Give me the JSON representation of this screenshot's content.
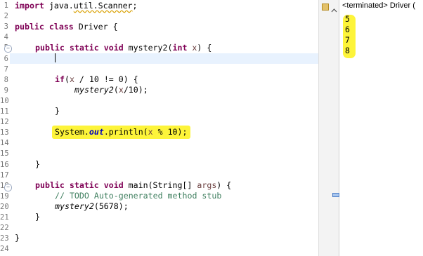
{
  "editor": {
    "line_numbers": [
      "1",
      "2",
      "3",
      "4",
      "5",
      "6",
      "7",
      "8",
      "9",
      "10",
      "11",
      "12",
      "13",
      "14",
      "15",
      "16",
      "17",
      "18",
      "19",
      "20",
      "21",
      "22",
      "23",
      "24"
    ],
    "code": {
      "l1_kw": "import",
      "l1_rest_a": " java.",
      "l1_squig": "util.Scanner",
      "l1_rest_b": ";",
      "l3_kw1": "public",
      "l3_kw2": "class",
      "l3_rest": " Driver {",
      "l5_kw1": "public",
      "l5_kw2": "static",
      "l5_kw3": "void",
      "l5_rest_a": " mystery2(",
      "l5_kw4": "int",
      "l5_var": "x",
      "l5_rest_b": ") {",
      "l8_kw": "if",
      "l8_rest_a": "(",
      "l8_var": "x",
      "l8_rest_b": " / 10 != 0) {",
      "l9_call": "mystery2",
      "l9_rest_a": "(",
      "l9_var": "x",
      "l9_rest_b": "/10);",
      "l11": "}",
      "l13_a": "System.",
      "l13_field": "out",
      "l13_b": ".println(",
      "l13_var": "x",
      "l13_c": " % 10);",
      "l16": "}",
      "l18_kw1": "public",
      "l18_kw2": "static",
      "l18_kw3": "void",
      "l18_rest_a": " main(String[] ",
      "l18_var": "args",
      "l18_rest_b": ") {",
      "l19": "// TODO Auto-generated method stub",
      "l20_call": "mystery2",
      "l20_rest": "(5678);",
      "l21": "}",
      "l23": "}"
    }
  },
  "console": {
    "header": "<terminated> Driver (",
    "output": [
      "5",
      "6",
      "7",
      "8"
    ]
  },
  "colors": {
    "highlight": "#fdf43a",
    "keyword": "#7f0055",
    "comment": "#3f7f5f",
    "current_line": "#e8f2fe"
  }
}
